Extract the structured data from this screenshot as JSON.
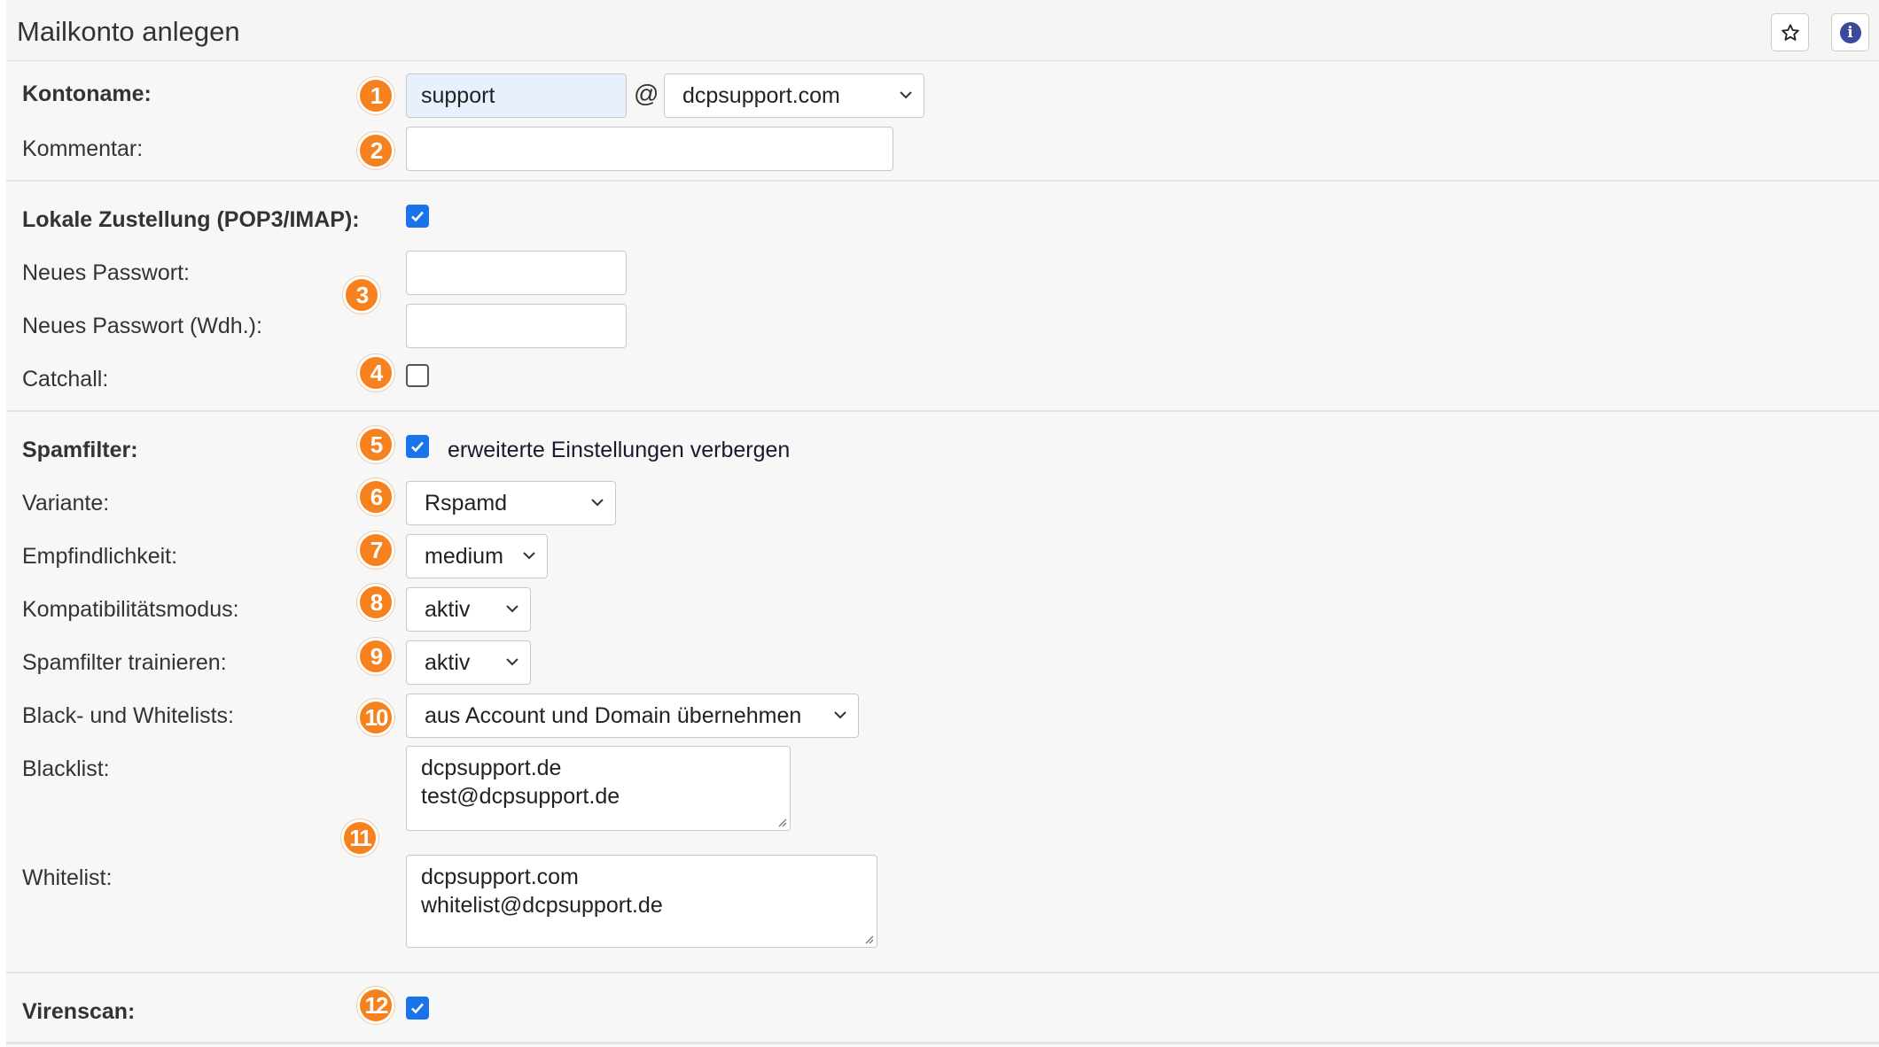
{
  "header": {
    "title": "Mailkonto anlegen"
  },
  "icons": {
    "star": "star-icon",
    "info": "info-icon"
  },
  "colors": {
    "badge": "#f5821f",
    "checkbox": "#1a73e8",
    "input_autofill": "#e8f0fe"
  },
  "badges": [
    "1",
    "2",
    "3",
    "4",
    "5",
    "6",
    "7",
    "8",
    "9",
    "10",
    "11",
    "12"
  ],
  "account": {
    "name_label": "Kontoname:",
    "name_value": "support",
    "at": "@",
    "domain_value": "dcpsupport.com",
    "comment_label": "Kommentar:",
    "comment_value": ""
  },
  "delivery": {
    "label": "Lokale Zustellung (POP3/IMAP):",
    "checked": true,
    "password_label": "Neues Passwort:",
    "password_repeat_label": "Neues Passwort (Wdh.):",
    "catchall_label": "Catchall:",
    "catchall_checked": false
  },
  "spamfilter": {
    "label": "Spamfilter:",
    "checked": true,
    "advanced_toggle_label": "erweiterte Einstellungen verbergen",
    "variant_label": "Variante:",
    "variant_value": "Rspamd",
    "sensitivity_label": "Empfindlichkeit:",
    "sensitivity_value": "medium",
    "compat_label": "Kompatibilitätsmodus:",
    "compat_value": "aktiv",
    "train_label": "Spamfilter trainieren:",
    "train_value": "aktiv",
    "lists_label": "Black- und Whitelists:",
    "lists_value": "aus Account und Domain übernehmen",
    "blacklist_label": "Blacklist:",
    "blacklist_lines": [
      "dcpsupport.de",
      "test@dcpsupport.de"
    ],
    "whitelist_label": "Whitelist:",
    "whitelist_lines": [
      "dcpsupport.com",
      "whitelist@dcpsupport.de"
    ]
  },
  "virusscan": {
    "label": "Virenscan:",
    "checked": true
  }
}
